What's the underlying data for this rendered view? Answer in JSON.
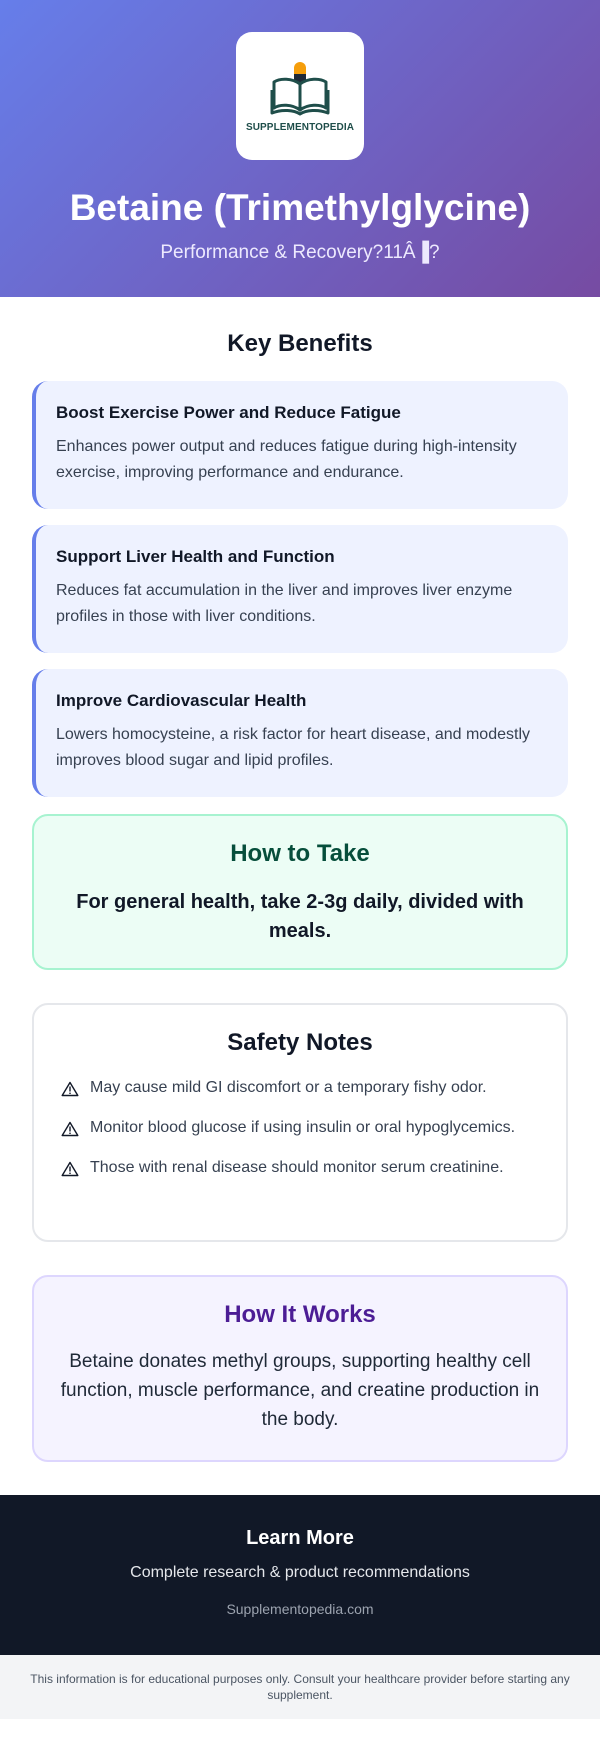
{
  "brand": {
    "logo_text": "SUPPLEMENTOPEDIA"
  },
  "hero": {
    "title": "Betaine (Trimethylglycine)",
    "subtitle": "Performance & Recovery?11Â▐?"
  },
  "benefits": {
    "heading": "Key Benefits",
    "items": [
      {
        "title": "Boost Exercise Power and Reduce Fatigue",
        "desc": "Enhances power output and reduces fatigue during high-intensity exercise, improving performance and endurance."
      },
      {
        "title": "Support Liver Health and Function",
        "desc": "Reduces fat accumulation in the liver and improves liver enzyme profiles in those with liver conditions."
      },
      {
        "title": "Improve Cardiovascular Health",
        "desc": "Lowers homocysteine, a risk factor for heart disease, and modestly improves blood sugar and lipid profiles."
      }
    ]
  },
  "how_to_take": {
    "heading": "How to Take",
    "text": "For general health, take 2-3g daily, divided with meals."
  },
  "safety": {
    "heading": "Safety Notes",
    "icon": "warning-icon",
    "items": [
      "May cause mild GI discomfort or a temporary fishy odor.",
      "Monitor blood glucose if using insulin or oral hypoglycemics.",
      "Those with renal disease should monitor serum creatinine."
    ]
  },
  "how_it_works": {
    "heading": "How It Works",
    "text": "Betaine donates methyl groups, supporting healthy cell function, muscle performance, and creatine production in the body."
  },
  "footer": {
    "heading": "Learn More",
    "subtitle": "Complete research & product recommendations",
    "link": "Supplementopedia.com"
  },
  "disclaimer": "This information is for educational purposes only. Consult your healthcare provider before starting any supplement.",
  "colors": {
    "hero_start": "#667eea",
    "hero_end": "#764ba2",
    "accent": "#667eea",
    "howto_title": "#064e3b",
    "works_title": "#4c1d95",
    "footer_bg": "#111827"
  }
}
